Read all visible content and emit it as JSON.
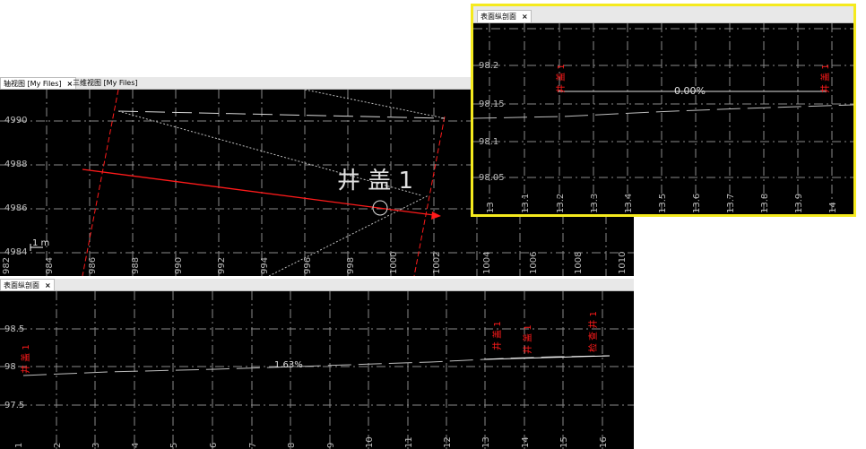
{
  "colors": {
    "background": "#000000",
    "grid": "#8a8a8a",
    "axis_text": "#bdbdbd",
    "red": "#ff1a1a",
    "highlight": "#f5ea1e"
  },
  "plan_view": {
    "tabs": [
      {
        "label": "轴视图 [My Files]",
        "close": "×",
        "active": true
      },
      {
        "label": "三维视图 [My Files]",
        "close": "",
        "active": false
      }
    ],
    "y_ticks": [
      "4990",
      "4988",
      "4986",
      "4984"
    ],
    "x_ticks": [
      "982",
      "984",
      "986",
      "988",
      "990",
      "992",
      "994",
      "996",
      "998",
      "1000",
      "1002",
      "1004",
      "1006",
      "1008",
      "1010"
    ],
    "scale_label": "1 m",
    "well_label": "井 盖 1"
  },
  "profile_main": {
    "tab": {
      "label": "表面纵剖面",
      "close": "×"
    },
    "y_ticks": [
      "98.5",
      "98",
      "97.5"
    ],
    "x_ticks": [
      "1",
      "2",
      "3",
      "4",
      "5",
      "6",
      "7",
      "8",
      "9",
      "10",
      "11",
      "12",
      "13",
      "14",
      "15",
      "16"
    ],
    "slope_label": "1.63%",
    "markers": [
      "井 盖 1",
      "井 盖 1",
      "井 盖 1",
      "检 查 井 1"
    ]
  },
  "profile_inset": {
    "tab": {
      "label": "表面纵剖面",
      "close": "×"
    },
    "y_ticks": [
      "98.2",
      "98.15",
      "98.1",
      "98.05"
    ],
    "x_ticks": [
      "13",
      "13.1",
      "13.2",
      "13.3",
      "13.4",
      "13.5",
      "13.6",
      "13.7",
      "13.8",
      "13.9",
      "14"
    ],
    "slope_label": "0.00%",
    "markers": [
      "井 盖 1",
      "井 盖 1"
    ]
  }
}
